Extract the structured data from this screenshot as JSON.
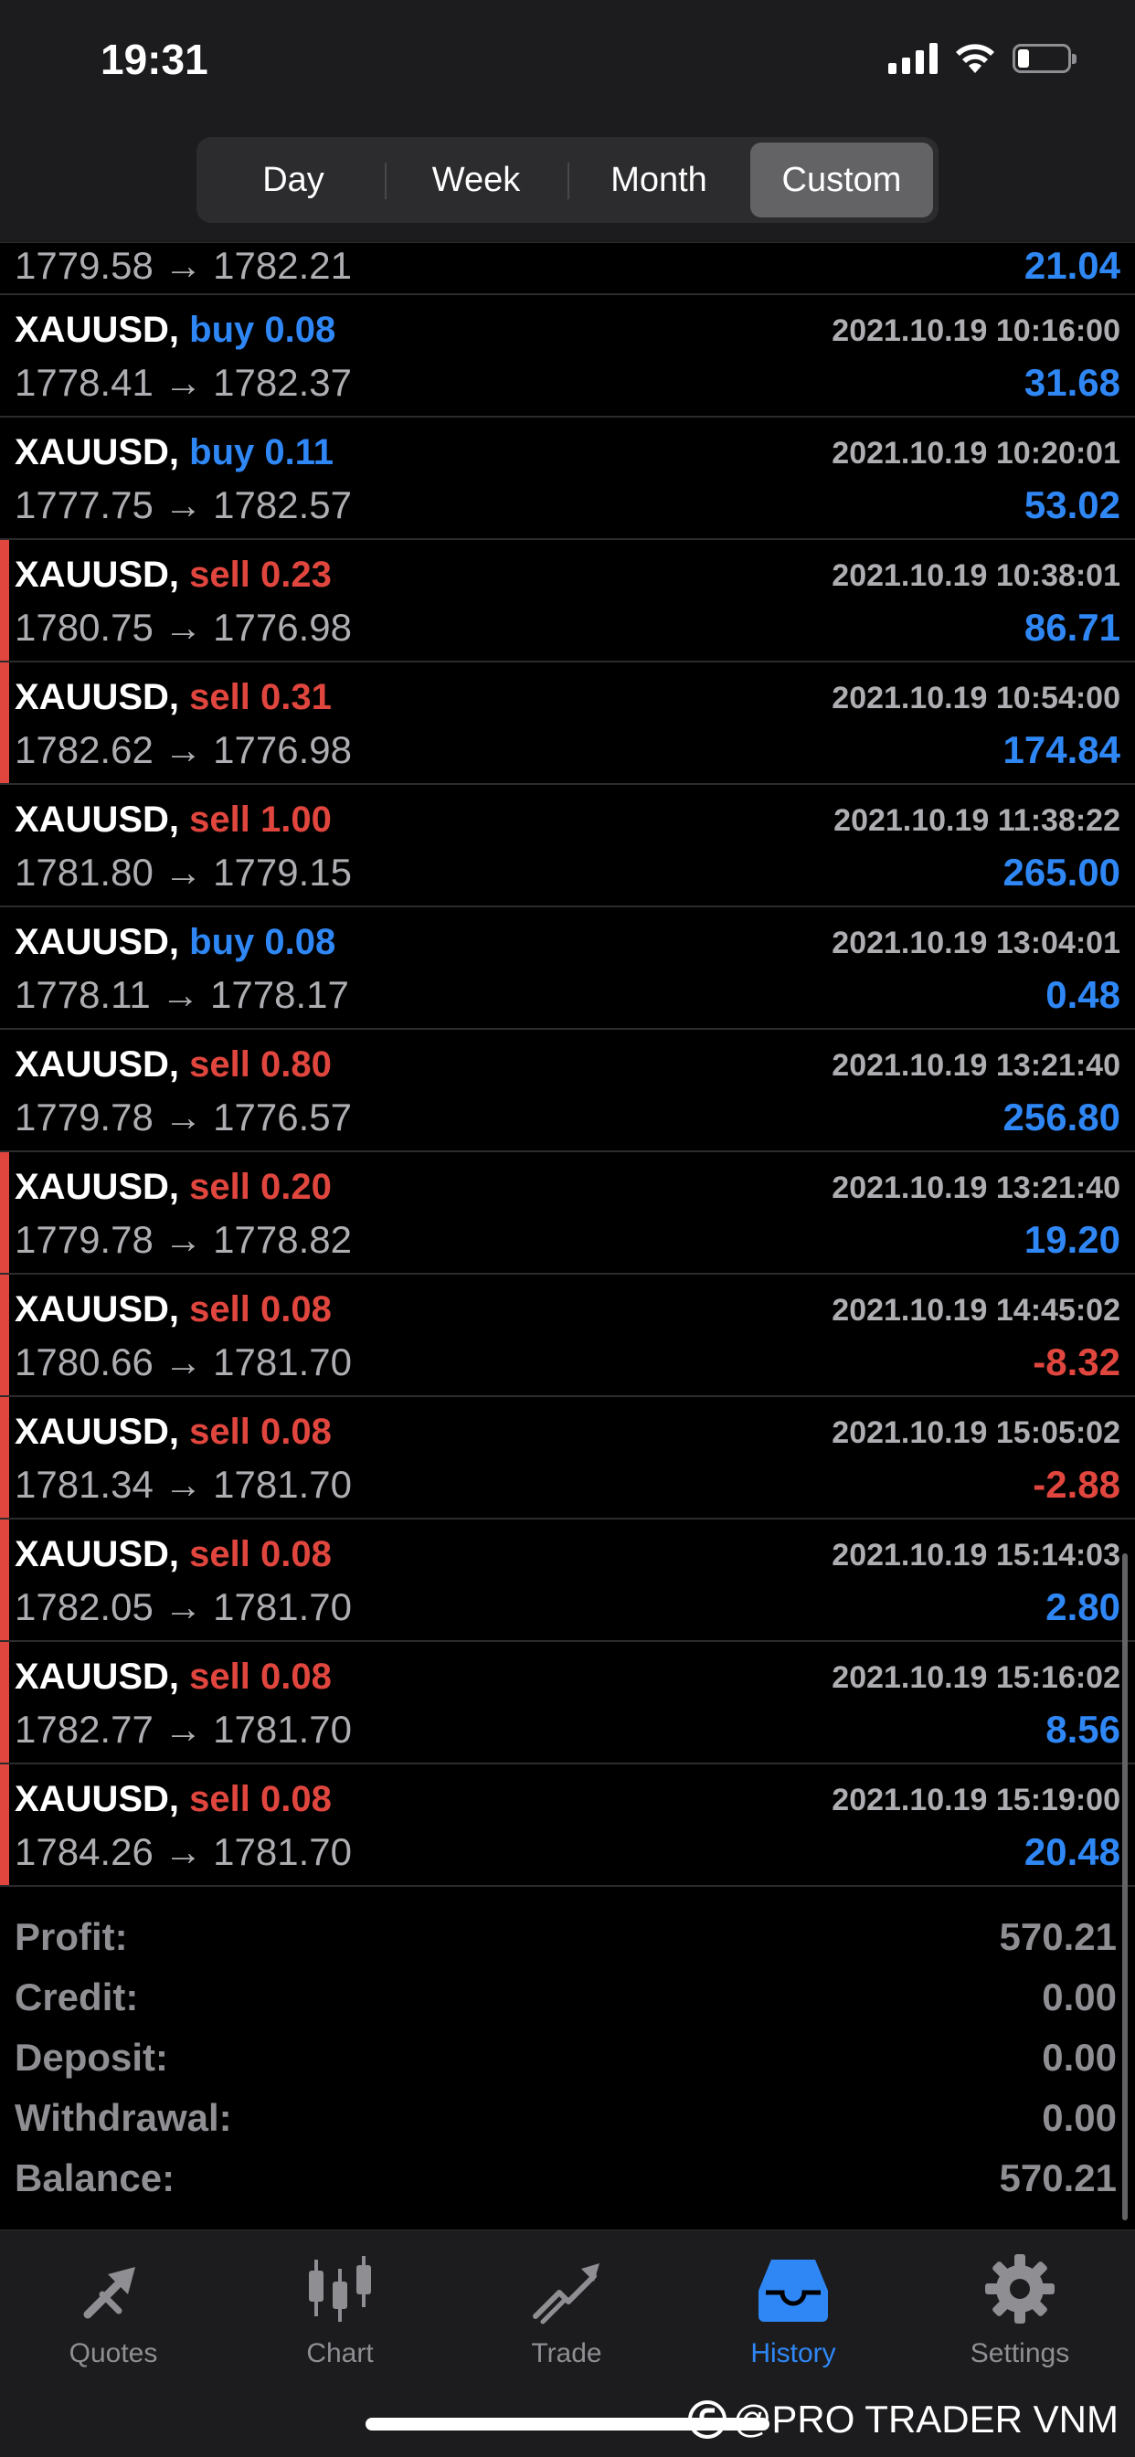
{
  "status_bar": {
    "time": "19:31"
  },
  "periods": [
    "Day",
    "Week",
    "Month",
    "Custom"
  ],
  "active_period": "Custom",
  "partial_row": {
    "prices": "1779.58 → 1782.21",
    "profit": "21.04"
  },
  "deals": [
    {
      "symbol": "XAUUSD,",
      "side": "buy 0.08",
      "dir": "buy",
      "time": "2021.10.19 10:16:00",
      "prices": "1778.41 → 1782.37",
      "profit": "31.68"
    },
    {
      "symbol": "XAUUSD,",
      "side": "buy 0.11",
      "dir": "buy",
      "time": "2021.10.19 10:20:01",
      "prices": "1777.75 → 1782.57",
      "profit": "53.02"
    },
    {
      "symbol": "XAUUSD,",
      "side": "sell 0.23",
      "dir": "sell",
      "time": "2021.10.19 10:38:01",
      "prices": "1780.75 → 1776.98",
      "profit": "86.71"
    },
    {
      "symbol": "XAUUSD,",
      "side": "sell 0.31",
      "dir": "sell",
      "time": "2021.10.19 10:54:00",
      "prices": "1782.62 → 1776.98",
      "profit": "174.84"
    },
    {
      "symbol": "XAUUSD,",
      "side": "sell 1.00",
      "dir": "sell",
      "time": "2021.10.19 11:38:22",
      "prices": "1781.80 → 1779.15",
      "profit": "265.00"
    },
    {
      "symbol": "XAUUSD,",
      "side": "buy 0.08",
      "dir": "buy",
      "time": "2021.10.19 13:04:01",
      "prices": "1778.11 → 1778.17",
      "profit": "0.48"
    },
    {
      "symbol": "XAUUSD,",
      "side": "sell 0.80",
      "dir": "sell",
      "time": "2021.10.19 13:21:40",
      "prices": "1779.78 → 1776.57",
      "profit": "256.80"
    },
    {
      "symbol": "XAUUSD,",
      "side": "sell 0.20",
      "dir": "sell",
      "time": "2021.10.19 13:21:40",
      "prices": "1779.78 → 1778.82",
      "profit": "19.20"
    },
    {
      "symbol": "XAUUSD,",
      "side": "sell 0.08",
      "dir": "sell",
      "time": "2021.10.19 14:45:02",
      "prices": "1780.66 → 1781.70",
      "profit": "-8.32"
    },
    {
      "symbol": "XAUUSD,",
      "side": "sell 0.08",
      "dir": "sell",
      "time": "2021.10.19 15:05:02",
      "prices": "1781.34 → 1781.70",
      "profit": "-2.88"
    },
    {
      "symbol": "XAUUSD,",
      "side": "sell 0.08",
      "dir": "sell",
      "time": "2021.10.19 15:14:03",
      "prices": "1782.05 → 1781.70",
      "profit": "2.80"
    },
    {
      "symbol": "XAUUSD,",
      "side": "sell 0.08",
      "dir": "sell",
      "time": "2021.10.19 15:16:02",
      "prices": "1782.77 → 1781.70",
      "profit": "8.56"
    },
    {
      "symbol": "XAUUSD,",
      "side": "sell 0.08",
      "dir": "sell",
      "time": "2021.10.19 15:19:00",
      "prices": "1784.26 → 1781.70",
      "profit": "20.48"
    }
  ],
  "summary": [
    {
      "label": "Profit:",
      "value": "570.21"
    },
    {
      "label": "Credit:",
      "value": "0.00"
    },
    {
      "label": "Deposit:",
      "value": "0.00"
    },
    {
      "label": "Withdrawal:",
      "value": "0.00"
    },
    {
      "label": "Balance:",
      "value": "570.21"
    }
  ],
  "tabs": [
    {
      "label": "Quotes",
      "icon": "quotes-icon"
    },
    {
      "label": "Chart",
      "icon": "chart-icon"
    },
    {
      "label": "Trade",
      "icon": "trade-icon"
    },
    {
      "label": "History",
      "icon": "history-icon"
    },
    {
      "label": "Settings",
      "icon": "gear-icon"
    }
  ],
  "active_tab": "History",
  "watermark": "@PRO TRADER VNM",
  "colors": {
    "buy": "#2f87f5",
    "sell": "#e0463e",
    "profit_positive": "#2f87f5",
    "profit_negative": "#e0463e",
    "accent": "#2f87f5"
  }
}
